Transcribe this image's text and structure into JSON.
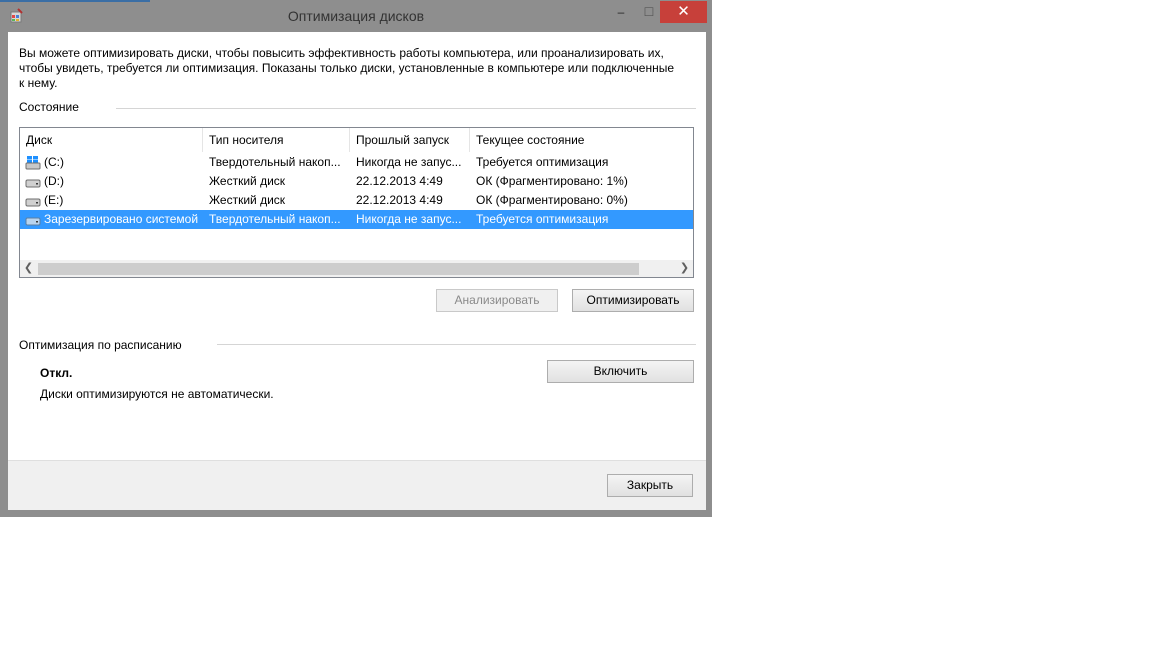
{
  "window": {
    "title": "Оптимизация дисков",
    "minimize_glyph": "–",
    "maximize_glyph": "☐",
    "close_glyph": "✕",
    "icon": "defrag-app-icon"
  },
  "intro_text": "Вы можете оптимизировать диски, чтобы повысить эффективность работы  компьютера, или проанализировать их, чтобы увидеть, требуется ли оптимизация. Показаны только диски, установленные в компьютере или подключенные к нему.",
  "status_section": {
    "label": "Состояние",
    "columns": [
      "Диск",
      "Тип носителя",
      "Прошлый запуск",
      "Текущее состояние"
    ],
    "rows": [
      {
        "disk": "(C:)",
        "media": "Твердотельный накоп...",
        "last_run": "Никогда не запус...",
        "state": "Требуется оптимизация",
        "icon": "system-drive-icon",
        "selected": false
      },
      {
        "disk": "(D:)",
        "media": "Жесткий диск",
        "last_run": "22.12.2013 4:49",
        "state": "ОК (Фрагментировано: 1%)",
        "icon": "hard-drive-icon",
        "selected": false
      },
      {
        "disk": "(E:)",
        "media": "Жесткий диск",
        "last_run": "22.12.2013 4:49",
        "state": "ОК (Фрагментировано: 0%)",
        "icon": "hard-drive-icon",
        "selected": false
      },
      {
        "disk": "Зарезервировано системой",
        "media": "Твердотельный накоп...",
        "last_run": "Никогда не запус...",
        "state": "Требуется оптимизация",
        "icon": "ssd-drive-icon",
        "selected": true
      }
    ],
    "scroll_left_glyph": "❮",
    "scroll_right_glyph": "❯",
    "analyze_label": "Анализировать",
    "optimize_label": "Оптимизировать"
  },
  "schedule_section": {
    "label": "Оптимизация по расписанию",
    "status": "Откл.",
    "description": "Диски оптимизируются не автоматически.",
    "enable_label": "Включить"
  },
  "footer": {
    "close_label": "Закрыть"
  },
  "colors": {
    "selection": "#3399ff",
    "close_button": "#c7403a",
    "window_frame": "#8e8e8e"
  }
}
